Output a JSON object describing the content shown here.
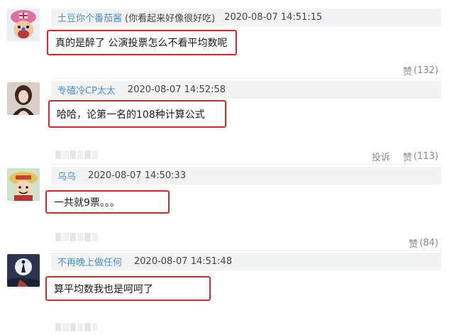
{
  "comments": [
    {
      "username": "土豆你个番茄酱",
      "username_note": "(你看起来好像很好吃)",
      "timestamp": "2020-08-07 14:51:15",
      "text": "真的是醉了 公演投票怎么不看平均数呢",
      "like_label": "赞",
      "like_count": "(132)",
      "report_label": "",
      "avatar_icon": "cartoon-reindeer-avatar"
    },
    {
      "username": "专磕冷CP太太",
      "username_note": "",
      "timestamp": "2020-08-07 14:52:58",
      "text": "哈哈，论第一名的108种计算公式",
      "like_label": "赞",
      "like_count": "(113)",
      "report_label": "投诉",
      "avatar_icon": "woman-portrait-avatar"
    },
    {
      "username": "乌乌",
      "username_note": "",
      "timestamp": "2020-08-07 14:50:33",
      "text": "一共就9票。。。",
      "like_label": "赞",
      "like_count": "(84)",
      "report_label": "",
      "avatar_icon": "cartoon-character-avatar"
    },
    {
      "username": "不再晚上做任何",
      "username_note": "",
      "timestamp": "2020-08-07 14:51:48",
      "text": "算平均数我也是呵呵了",
      "like_label": "",
      "like_count": "",
      "report_label": "",
      "avatar_icon": "moon-silhouette-avatar"
    }
  ],
  "colors": {
    "username": "#4a90c8",
    "highlight_border": "#d62a2a",
    "meta_background": "#f2f3f5",
    "action_text": "#8a8a8a"
  }
}
